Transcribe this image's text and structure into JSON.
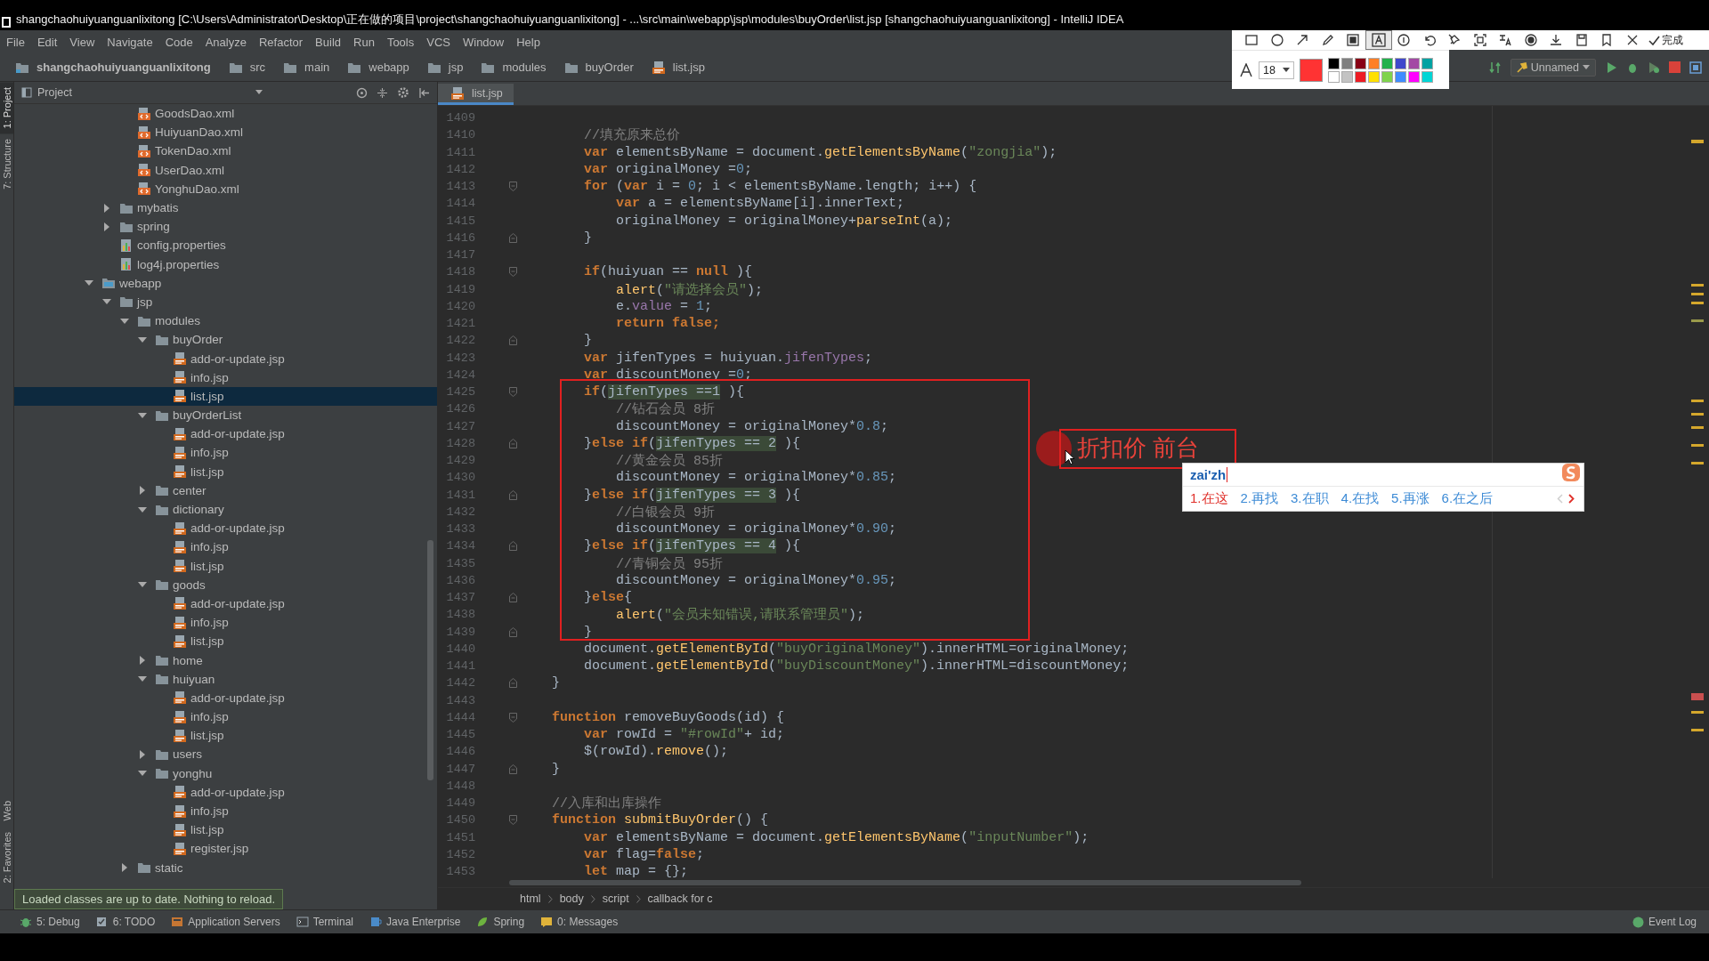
{
  "window": {
    "title": "shangchaohuiyuanguanlixitong [C:\\Users\\Administrator\\Desktop\\正在做的项目\\project\\shangchaohuiyuanguanlixitong] - ...\\src\\main\\webapp\\jsp\\modules\\buyOrder\\list.jsp [shangchaohuiyuanguanlixitong] - IntelliJ IDEA"
  },
  "menu": [
    "File",
    "Edit",
    "View",
    "Navigate",
    "Code",
    "Analyze",
    "Refactor",
    "Build",
    "Run",
    "Tools",
    "VCS",
    "Window",
    "Help"
  ],
  "breadcrumbs": [
    {
      "label": "shangchaohuiyuanguanlixitong",
      "kind": "project"
    },
    {
      "label": "src",
      "kind": "folder"
    },
    {
      "label": "main",
      "kind": "folder"
    },
    {
      "label": "webapp",
      "kind": "folder"
    },
    {
      "label": "jsp",
      "kind": "folder"
    },
    {
      "label": "modules",
      "kind": "folder"
    },
    {
      "label": "buyOrder",
      "kind": "folder"
    },
    {
      "label": "list.jsp",
      "kind": "jsp"
    }
  ],
  "run_toolbar": {
    "configuration": "Unnamed"
  },
  "side_tabs": [
    {
      "label": "1: Project",
      "selected": true
    },
    {
      "label": "7: Structure",
      "selected": false
    },
    {
      "label": "Web",
      "selected": false
    },
    {
      "label": "2: Favorites",
      "selected": false
    }
  ],
  "project_panel": {
    "title": "Project",
    "notification": "Loaded classes are up to date. Nothing to reload.",
    "tree": [
      {
        "kind": "offscreen",
        "children": [
          {
            "kind": "offscreen",
            "children": [
              {
                "label": "GoodsDao.xml",
                "kind": "xml",
                "selected": false
              },
              {
                "label": "HuiyuanDao.xml",
                "kind": "xml",
                "selected": false
              },
              {
                "label": "TokenDao.xml",
                "kind": "xml",
                "selected": false
              },
              {
                "label": "UserDao.xml",
                "kind": "xml",
                "selected": false
              },
              {
                "label": "YonghuDao.xml",
                "kind": "xml",
                "selected": false
              }
            ]
          },
          {
            "label": "mybatis",
            "kind": "folder",
            "expanded": false,
            "selected": false
          },
          {
            "label": "spring",
            "kind": "folder",
            "expanded": false,
            "selected": false
          },
          {
            "label": "config.properties",
            "kind": "properties",
            "selected": false
          },
          {
            "label": "log4j.properties",
            "kind": "properties",
            "selected": false
          }
        ]
      },
      {
        "label": "webapp",
        "kind": "webfolder",
        "expanded": true,
        "selected": false,
        "children": [
          {
            "label": "jsp",
            "kind": "folder",
            "expanded": true,
            "selected": false,
            "children": [
              {
                "label": "modules",
                "kind": "folder",
                "expanded": true,
                "selected": false,
                "children": [
                  {
                    "label": "buyOrder",
                    "kind": "folder",
                    "expanded": true,
                    "selected": false,
                    "children": [
                      {
                        "label": "add-or-update.jsp",
                        "kind": "jsp",
                        "selected": false
                      },
                      {
                        "label": "info.jsp",
                        "kind": "jsp",
                        "selected": false
                      },
                      {
                        "label": "list.jsp",
                        "kind": "jsp",
                        "selected": true
                      }
                    ]
                  },
                  {
                    "label": "buyOrderList",
                    "kind": "folder",
                    "expanded": true,
                    "selected": false,
                    "children": [
                      {
                        "label": "add-or-update.jsp",
                        "kind": "jsp",
                        "selected": false
                      },
                      {
                        "label": "info.jsp",
                        "kind": "jsp",
                        "selected": false
                      },
                      {
                        "label": "list.jsp",
                        "kind": "jsp",
                        "selected": false
                      }
                    ]
                  },
                  {
                    "label": "center",
                    "kind": "folder",
                    "expanded": false,
                    "selected": false
                  },
                  {
                    "label": "dictionary",
                    "kind": "folder",
                    "expanded": true,
                    "selected": false,
                    "children": [
                      {
                        "label": "add-or-update.jsp",
                        "kind": "jsp",
                        "selected": false
                      },
                      {
                        "label": "info.jsp",
                        "kind": "jsp",
                        "selected": false
                      },
                      {
                        "label": "list.jsp",
                        "kind": "jsp",
                        "selected": false
                      }
                    ]
                  },
                  {
                    "label": "goods",
                    "kind": "folder",
                    "expanded": true,
                    "selected": false,
                    "children": [
                      {
                        "label": "add-or-update.jsp",
                        "kind": "jsp",
                        "selected": false
                      },
                      {
                        "label": "info.jsp",
                        "kind": "jsp",
                        "selected": false
                      },
                      {
                        "label": "list.jsp",
                        "kind": "jsp",
                        "selected": false
                      }
                    ]
                  },
                  {
                    "label": "home",
                    "kind": "folder",
                    "expanded": false,
                    "selected": false
                  },
                  {
                    "label": "huiyuan",
                    "kind": "folder",
                    "expanded": true,
                    "selected": false,
                    "children": [
                      {
                        "label": "add-or-update.jsp",
                        "kind": "jsp",
                        "selected": false
                      },
                      {
                        "label": "info.jsp",
                        "kind": "jsp",
                        "selected": false
                      },
                      {
                        "label": "list.jsp",
                        "kind": "jsp",
                        "selected": false
                      }
                    ]
                  },
                  {
                    "label": "users",
                    "kind": "folder",
                    "expanded": false,
                    "selected": false
                  },
                  {
                    "label": "yonghu",
                    "kind": "folder",
                    "expanded": true,
                    "selected": false,
                    "children": [
                      {
                        "label": "add-or-update.jsp",
                        "kind": "jsp",
                        "selected": false
                      },
                      {
                        "label": "info.jsp",
                        "kind": "jsp",
                        "selected": false
                      },
                      {
                        "label": "list.jsp",
                        "kind": "jsp",
                        "selected": false
                      },
                      {
                        "label": "register.jsp",
                        "kind": "jsp",
                        "selected": false
                      }
                    ]
                  }
                ]
              },
              {
                "label": "static",
                "kind": "folder",
                "expanded": false,
                "selected": false
              }
            ]
          }
        ]
      }
    ]
  },
  "editor": {
    "tabs": [
      {
        "label": "list.jsp",
        "selected": true
      }
    ],
    "lines": [
      {
        "number": "1409"
      },
      {
        "number": "1410",
        "tokens": [
          {
            "kind": "comment",
            "text": "        //填充原来总价"
          }
        ]
      },
      {
        "number": "1411",
        "tokens": [
          {
            "kind": "keyword",
            "text": "        var"
          },
          {
            "kind": "plain",
            "text": " elementsByName = document."
          },
          {
            "kind": "method",
            "text": "getElementsByName"
          },
          {
            "kind": "plain",
            "text": "("
          },
          {
            "kind": "string",
            "text": "\"zongjia\""
          },
          {
            "kind": "plain",
            "text": ");"
          }
        ]
      },
      {
        "number": "1412",
        "tokens": [
          {
            "kind": "keyword",
            "text": "        var"
          },
          {
            "kind": "plain",
            "text": " originalMoney ="
          },
          {
            "kind": "number",
            "text": "0"
          },
          {
            "kind": "plain",
            "text": ";"
          }
        ]
      },
      {
        "number": "1413",
        "fold_start": true,
        "tokens": [
          {
            "kind": "keyword",
            "text": "        for"
          },
          {
            "kind": "plain",
            "text": " ("
          },
          {
            "kind": "keyword",
            "text": "var"
          },
          {
            "kind": "plain",
            "text": " i = "
          },
          {
            "kind": "number",
            "text": "0"
          },
          {
            "kind": "plain",
            "text": "; i < elementsByName.length; i++) {"
          }
        ]
      },
      {
        "number": "1414",
        "tokens": [
          {
            "kind": "keyword",
            "text": "            var"
          },
          {
            "kind": "plain",
            "text": " a = elementsByName[i].innerText;"
          }
        ]
      },
      {
        "number": "1415",
        "tokens": [
          {
            "kind": "plain",
            "text": "            originalMoney = originalMoney+"
          },
          {
            "kind": "method",
            "text": "parseInt"
          },
          {
            "kind": "plain",
            "text": "(a);"
          }
        ]
      },
      {
        "number": "1416",
        "fold_end": true,
        "tokens": [
          {
            "kind": "plain",
            "text": "        }"
          }
        ]
      },
      {
        "number": "1417"
      },
      {
        "number": "1418",
        "fold_start": true,
        "tokens": [
          {
            "kind": "keyword",
            "text": "        if"
          },
          {
            "kind": "plain",
            "text": "(huiyuan == "
          },
          {
            "kind": "keyword",
            "text": "null"
          },
          {
            "kind": "plain",
            "text": " ){"
          }
        ]
      },
      {
        "number": "1419",
        "tokens": [
          {
            "kind": "method",
            "text": "            alert"
          },
          {
            "kind": "plain",
            "text": "("
          },
          {
            "kind": "string",
            "text": "\"请选择会员\""
          },
          {
            "kind": "plain",
            "text": ");"
          }
        ]
      },
      {
        "number": "1420",
        "tokens": [
          {
            "kind": "plain",
            "text": "            e."
          },
          {
            "kind": "field",
            "text": "value"
          },
          {
            "kind": "plain",
            "text": " = "
          },
          {
            "kind": "number",
            "text": "1"
          },
          {
            "kind": "plain",
            "text": ";"
          }
        ]
      },
      {
        "number": "1421",
        "tokens": [
          {
            "kind": "keyword",
            "text": "            return false;"
          }
        ]
      },
      {
        "number": "1422",
        "fold_end": true,
        "tokens": [
          {
            "kind": "plain",
            "text": "        }"
          }
        ]
      },
      {
        "number": "1423",
        "tokens": [
          {
            "kind": "keyword",
            "text": "        var"
          },
          {
            "kind": "plain",
            "text": " jifenTypes = huiyuan."
          },
          {
            "kind": "field",
            "text": "jifenTypes"
          },
          {
            "kind": "plain",
            "text": ";"
          }
        ]
      },
      {
        "number": "1424",
        "tokens": [
          {
            "kind": "keyword",
            "text": "        var"
          },
          {
            "kind": "plain",
            "text": " discountMoney ="
          },
          {
            "kind": "number",
            "text": "0"
          },
          {
            "kind": "plain",
            "text": ";"
          }
        ]
      },
      {
        "number": "1425",
        "fold_start": true,
        "tokens": [
          {
            "kind": "keyword",
            "text": "        if"
          },
          {
            "kind": "plain",
            "text": "("
          },
          {
            "kind": "match",
            "text": "jifenTypes ==1"
          },
          {
            "kind": "plain",
            "text": " ){"
          }
        ]
      },
      {
        "number": "1426",
        "tokens": [
          {
            "kind": "comment",
            "text": "            //钻石会员 8折"
          }
        ]
      },
      {
        "number": "1427",
        "tokens": [
          {
            "kind": "plain",
            "text": "            discountMoney = originalMoney*"
          },
          {
            "kind": "number",
            "text": "0.8"
          },
          {
            "kind": "plain",
            "text": ";"
          }
        ]
      },
      {
        "number": "1428",
        "fold_end": true,
        "tokens": [
          {
            "kind": "plain",
            "text": "        }"
          },
          {
            "kind": "keyword",
            "text": "else if"
          },
          {
            "kind": "plain",
            "text": "("
          },
          {
            "kind": "match",
            "text": "jifenTypes == 2"
          },
          {
            "kind": "plain",
            "text": " ){"
          }
        ]
      },
      {
        "number": "1429",
        "tokens": [
          {
            "kind": "comment",
            "text": "            //黄金会员 85折"
          }
        ]
      },
      {
        "number": "1430",
        "tokens": [
          {
            "kind": "plain",
            "text": "            discountMoney = originalMoney*"
          },
          {
            "kind": "number",
            "text": "0.85"
          },
          {
            "kind": "plain",
            "text": ";"
          }
        ]
      },
      {
        "number": "1431",
        "fold_end": true,
        "tokens": [
          {
            "kind": "plain",
            "text": "        }"
          },
          {
            "kind": "keyword",
            "text": "else if"
          },
          {
            "kind": "plain",
            "text": "("
          },
          {
            "kind": "match",
            "text": "jifenTypes == 3"
          },
          {
            "kind": "plain",
            "text": " ){"
          }
        ]
      },
      {
        "number": "1432",
        "tokens": [
          {
            "kind": "comment",
            "text": "            //白银会员 9折"
          }
        ]
      },
      {
        "number": "1433",
        "tokens": [
          {
            "kind": "plain",
            "text": "            discountMoney = originalMoney*"
          },
          {
            "kind": "number",
            "text": "0.90"
          },
          {
            "kind": "plain",
            "text": ";"
          }
        ]
      },
      {
        "number": "1434",
        "fold_end": true,
        "tokens": [
          {
            "kind": "plain",
            "text": "        }"
          },
          {
            "kind": "keyword",
            "text": "else if"
          },
          {
            "kind": "plain",
            "text": "("
          },
          {
            "kind": "match",
            "text": "jifenTypes == 4"
          },
          {
            "kind": "plain",
            "text": " ){"
          }
        ]
      },
      {
        "number": "1435",
        "tokens": [
          {
            "kind": "comment",
            "text": "            //青铜会员 95折"
          }
        ]
      },
      {
        "number": "1436",
        "tokens": [
          {
            "kind": "plain",
            "text": "            discountMoney = originalMoney*"
          },
          {
            "kind": "number",
            "text": "0.95"
          },
          {
            "kind": "plain",
            "text": ";"
          }
        ]
      },
      {
        "number": "1437",
        "fold_end": true,
        "tokens": [
          {
            "kind": "plain",
            "text": "        }"
          },
          {
            "kind": "keyword",
            "text": "else"
          },
          {
            "kind": "plain",
            "text": "{"
          }
        ]
      },
      {
        "number": "1438",
        "tokens": [
          {
            "kind": "method",
            "text": "            alert"
          },
          {
            "kind": "plain",
            "text": "("
          },
          {
            "kind": "string",
            "text": "\"会员未知错误,请联系管理员\""
          },
          {
            "kind": "plain",
            "text": ");"
          }
        ]
      },
      {
        "number": "1439",
        "fold_end": true,
        "tokens": [
          {
            "kind": "plain",
            "text": "        }"
          }
        ]
      },
      {
        "number": "1440",
        "tokens": [
          {
            "kind": "plain",
            "text": "        document."
          },
          {
            "kind": "method",
            "text": "getElementById"
          },
          {
            "kind": "plain",
            "text": "("
          },
          {
            "kind": "string",
            "text": "\"buyOriginalMoney\""
          },
          {
            "kind": "plain",
            "text": ").innerHTML=originalMoney;"
          }
        ]
      },
      {
        "number": "1441",
        "tokens": [
          {
            "kind": "plain",
            "text": "        document."
          },
          {
            "kind": "method",
            "text": "getElementById"
          },
          {
            "kind": "plain",
            "text": "("
          },
          {
            "kind": "string",
            "text": "\"buyDiscountMoney\""
          },
          {
            "kind": "plain",
            "text": ").innerHTML=discountMoney;"
          }
        ]
      },
      {
        "number": "1442",
        "fold_end": true,
        "tokens": [
          {
            "kind": "plain",
            "text": "    }"
          }
        ]
      },
      {
        "number": "1443"
      },
      {
        "number": "1444",
        "fold_start": true,
        "tokens": [
          {
            "kind": "keyword",
            "text": "    function"
          },
          {
            "kind": "plain",
            "text": " removeBuyGoods(id) {"
          }
        ]
      },
      {
        "number": "1445",
        "tokens": [
          {
            "kind": "keyword",
            "text": "        var"
          },
          {
            "kind": "plain",
            "text": " rowId = "
          },
          {
            "kind": "string",
            "text": "\"#rowId\""
          },
          {
            "kind": "plain",
            "text": "+ id;"
          }
        ]
      },
      {
        "number": "1446",
        "tokens": [
          {
            "kind": "plain",
            "text": "        $(rowId)."
          },
          {
            "kind": "method",
            "text": "remove"
          },
          {
            "kind": "plain",
            "text": "();"
          }
        ]
      },
      {
        "number": "1447",
        "fold_end": true,
        "tokens": [
          {
            "kind": "plain",
            "text": "    }"
          }
        ]
      },
      {
        "number": "1448"
      },
      {
        "number": "1449",
        "tokens": [
          {
            "kind": "comment",
            "text": "    //入库和出库操作"
          }
        ]
      },
      {
        "number": "1450",
        "fold_start": true,
        "tokens": [
          {
            "kind": "keyword",
            "text": "    function"
          },
          {
            "kind": "method",
            "text": " submitBuyOrder"
          },
          {
            "kind": "plain",
            "text": "() {"
          }
        ]
      },
      {
        "number": "1451",
        "tokens": [
          {
            "kind": "keyword",
            "text": "        var"
          },
          {
            "kind": "plain",
            "text": " elementsByName = document."
          },
          {
            "kind": "method",
            "text": "getElementsByName"
          },
          {
            "kind": "plain",
            "text": "("
          },
          {
            "kind": "string",
            "text": "\"inputNumber\""
          },
          {
            "kind": "plain",
            "text": ");"
          }
        ]
      },
      {
        "number": "1452",
        "tokens": [
          {
            "kind": "keyword",
            "text": "        var"
          },
          {
            "kind": "plain",
            "text": " flag="
          },
          {
            "kind": "keyword",
            "text": "false"
          },
          {
            "kind": "plain",
            "text": ";"
          }
        ]
      },
      {
        "number": "1453",
        "tokens": [
          {
            "kind": "keyword",
            "text": "        let"
          },
          {
            "kind": "plain",
            "text": " map = {};"
          }
        ]
      }
    ],
    "breadcrumbs": [
      "html",
      "body",
      "script",
      "callback for c"
    ]
  },
  "annotation": {
    "text": "折扣价 前台"
  },
  "input_method": {
    "composition": "zai'zh",
    "candidates": [
      {
        "label": "1.在这",
        "selected": true
      },
      {
        "label": "2.再找",
        "selected": false
      },
      {
        "label": "3.在职",
        "selected": false
      },
      {
        "label": "4.在找",
        "selected": false
      },
      {
        "label": "5.再涨",
        "selected": false
      },
      {
        "label": "6.在之后",
        "selected": false
      }
    ]
  },
  "screenshot_toolbar": {
    "tools": [
      {
        "kind": "rect",
        "selected": false
      },
      {
        "kind": "ellipse",
        "selected": false
      },
      {
        "kind": "arrow",
        "selected": false
      },
      {
        "kind": "pencil",
        "selected": false
      },
      {
        "kind": "marker",
        "selected": false
      },
      {
        "kind": "text",
        "selected": true
      },
      {
        "kind": "number",
        "selected": false
      },
      {
        "kind": "undo",
        "selected": false
      },
      {
        "kind": "pin",
        "selected": false
      },
      {
        "kind": "ocr",
        "selected": false
      },
      {
        "kind": "translate",
        "selected": false
      },
      {
        "kind": "record",
        "selected": false
      },
      {
        "kind": "download",
        "selected": false
      },
      {
        "kind": "save",
        "selected": false
      },
      {
        "kind": "bookmark",
        "selected": false
      },
      {
        "kind": "close",
        "selected": false
      }
    ],
    "done_label": "完成",
    "font_size": "18",
    "selected_color": {
      "color": "#ff3333"
    },
    "palette": [
      {
        "color": "#000000"
      },
      {
        "color": "#7f7f7f"
      },
      {
        "color": "#880015"
      },
      {
        "color": "#ff7f27"
      },
      {
        "color": "#22b14c"
      },
      {
        "color": "#3f48cc"
      },
      {
        "color": "#a349a4"
      },
      {
        "color": "#00a2a2"
      },
      {
        "color": "#ffffff"
      },
      {
        "color": "#c3c3c3"
      },
      {
        "color": "#ed1c24"
      },
      {
        "color": "#ffe000"
      },
      {
        "color": "#7fd34c"
      },
      {
        "color": "#3f8cff"
      },
      {
        "color": "#ff00ff"
      },
      {
        "color": "#00d5d5"
      }
    ]
  },
  "tool_windows": [
    {
      "label": "5: Debug",
      "kind": "debug"
    },
    {
      "label": "6: TODO",
      "kind": "todo"
    },
    {
      "label": "Application Servers",
      "kind": "server"
    },
    {
      "label": "Terminal",
      "kind": "terminal"
    },
    {
      "label": "Java Enterprise",
      "kind": "enterprise"
    },
    {
      "label": "Spring",
      "kind": "spring"
    },
    {
      "label": "0: Messages",
      "kind": "messages"
    }
  ],
  "event_log": "Event Log"
}
